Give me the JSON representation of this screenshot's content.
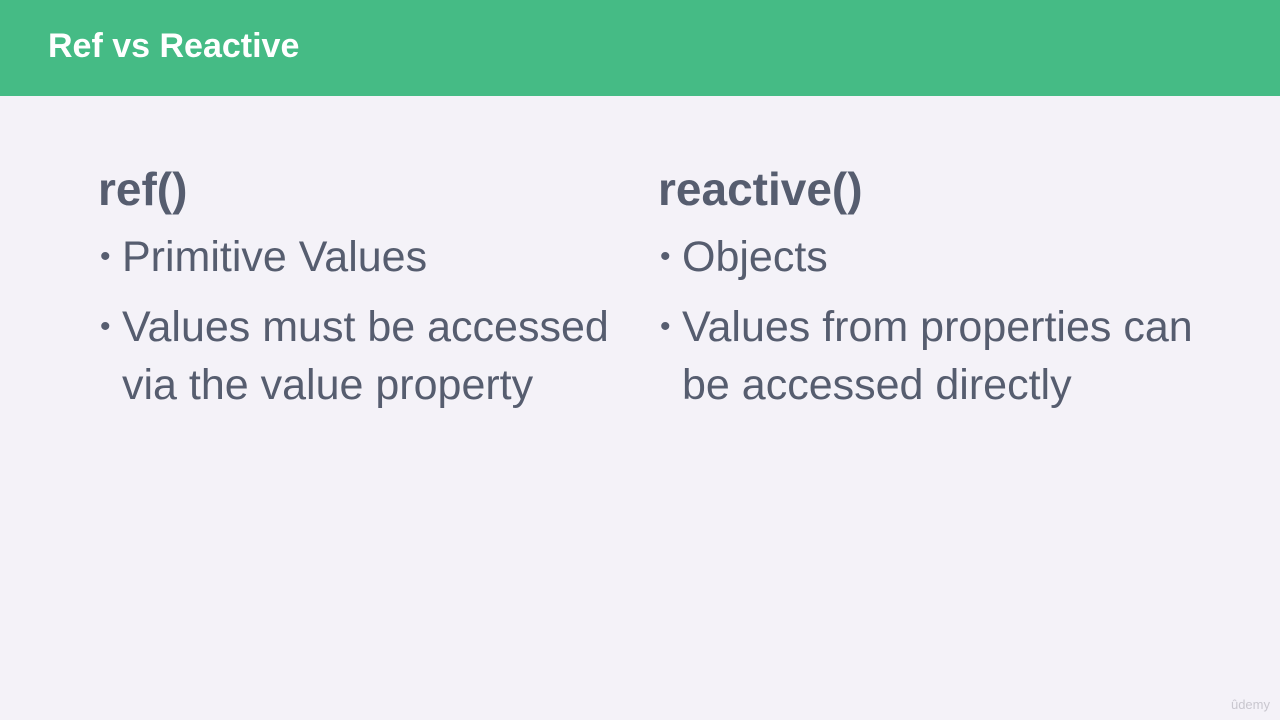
{
  "title": "Ref vs Reactive",
  "columns": [
    {
      "heading": "ref()",
      "bullets": [
        "Primitive Values",
        "Values must be accessed via the value property"
      ]
    },
    {
      "heading": "reactive()",
      "bullets": [
        "Objects",
        "Values from properties can be accessed directly"
      ]
    }
  ],
  "watermark": "ûdemy",
  "colors": {
    "title_bar": "#45bb85",
    "background": "#f4f2f8",
    "text": "#565d6f"
  }
}
